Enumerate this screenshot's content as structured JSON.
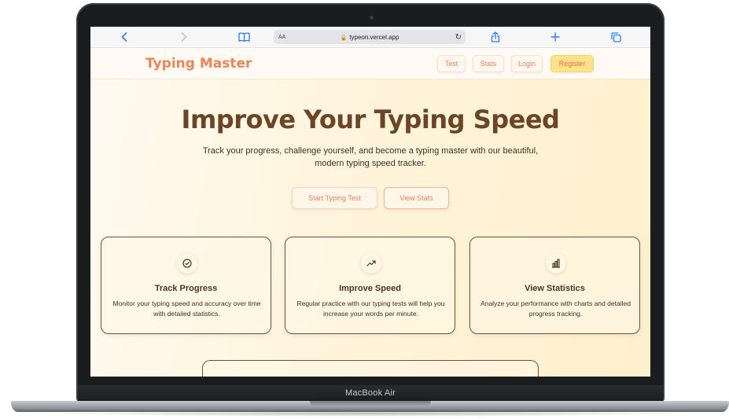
{
  "device": {
    "label": "MacBook Air"
  },
  "browser": {
    "url": "typeon.vercel.app",
    "text_size_label": "AA",
    "icons": [
      "back-icon",
      "forward-icon",
      "bookmarks-icon",
      "lock-icon",
      "reload-icon",
      "share-icon",
      "new-tab-icon",
      "tabs-icon"
    ]
  },
  "header": {
    "logo": "Typing Master",
    "nav": {
      "test": "Test",
      "stats": "Stats",
      "login": "Login",
      "register": "Register"
    }
  },
  "hero": {
    "title": "Improve Your Typing Speed",
    "subtitle": "Track your progress, challenge yourself, and become a typing master with our beautiful, modern typing speed tracker.",
    "primary_cta": "Start Typing Test",
    "secondary_cta": "View Stats"
  },
  "features": [
    {
      "icon": "check-circle-icon",
      "title": "Track Progress",
      "description": "Monitor your typing speed and accuracy over time with detailed statistics."
    },
    {
      "icon": "trending-up-icon",
      "title": "Improve Speed",
      "description": "Regular practice with our typing tests will help you increase your words per minute."
    },
    {
      "icon": "bar-chart-icon",
      "title": "View Statistics",
      "description": "Analyze your performance with charts and detailed progress tracking."
    }
  ],
  "colors": {
    "brand": "#ec8559",
    "heading": "#6b4526",
    "register_bg": "#ffe28a",
    "page_bg": "#fff4dc"
  }
}
